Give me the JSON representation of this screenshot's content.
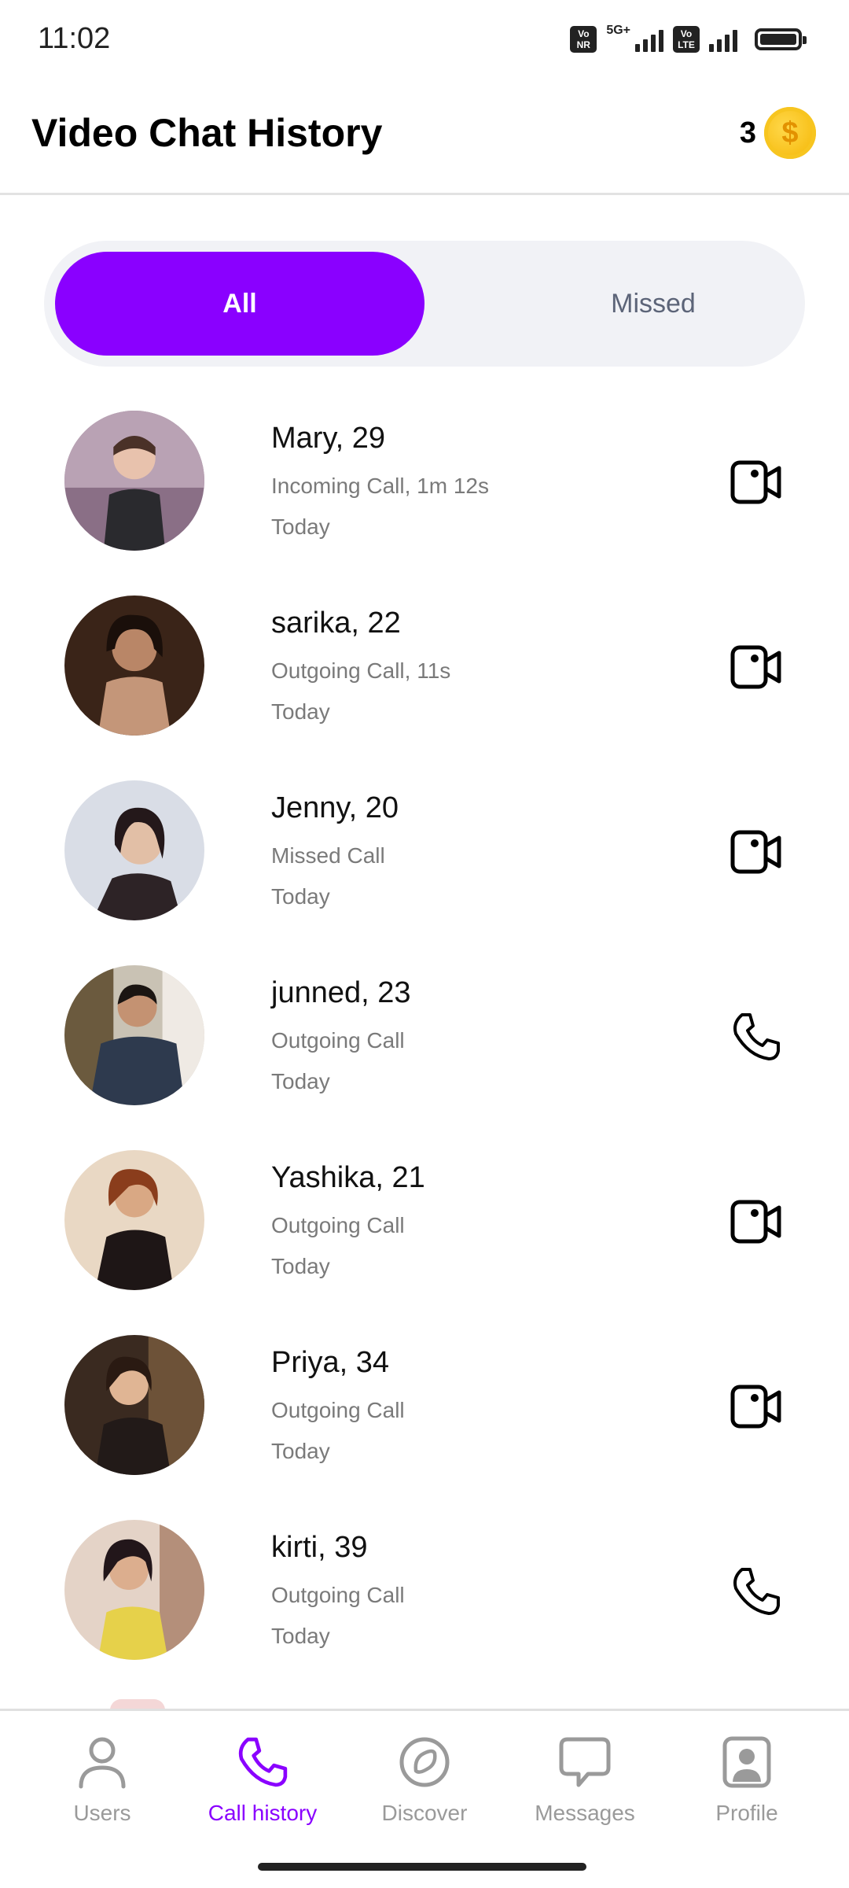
{
  "status_bar": {
    "time": "11:02",
    "net_badge_1": [
      "Vo",
      "NR"
    ],
    "net_5g": "5G+",
    "net_badge_2": [
      "Vo",
      "LTE"
    ]
  },
  "header": {
    "title": "Video Chat History",
    "coin_count": "3",
    "coin_symbol": "$"
  },
  "tabs": {
    "all": "All",
    "missed": "Missed",
    "selected": "All"
  },
  "calls": [
    {
      "name": "Mary, 29",
      "detail": "Incoming Call, 1m 12s",
      "when": "Today",
      "type": "video"
    },
    {
      "name": "sarika, 22",
      "detail": "Outgoing Call, 11s",
      "when": "Today",
      "type": "video"
    },
    {
      "name": "Jenny, 20",
      "detail": "Missed Call",
      "when": "Today",
      "type": "video"
    },
    {
      "name": "junned, 23",
      "detail": "Outgoing Call",
      "when": "Today",
      "type": "audio"
    },
    {
      "name": "Yashika, 21",
      "detail": "Outgoing Call",
      "when": "Today",
      "type": "video"
    },
    {
      "name": "Priya, 34",
      "detail": "Outgoing Call",
      "when": "Today",
      "type": "video"
    },
    {
      "name": "kirti, 39",
      "detail": "Outgoing Call",
      "when": "Today",
      "type": "audio"
    }
  ],
  "bottom_nav": [
    {
      "label": "Users",
      "icon": "user-icon",
      "active": false
    },
    {
      "label": "Call history",
      "icon": "phone-icon",
      "active": true
    },
    {
      "label": "Discover",
      "icon": "compass-icon",
      "active": false
    },
    {
      "label": "Messages",
      "icon": "chat-bubble-icon",
      "active": false
    },
    {
      "label": "Profile",
      "icon": "profile-card-icon",
      "active": false
    }
  ],
  "colors": {
    "accent": "#8a00ff",
    "tab_bg": "#f1f2f6",
    "muted_text": "#7a7a7a",
    "nav_inactive": "#9a9a9a",
    "coin": "#f4b400"
  }
}
